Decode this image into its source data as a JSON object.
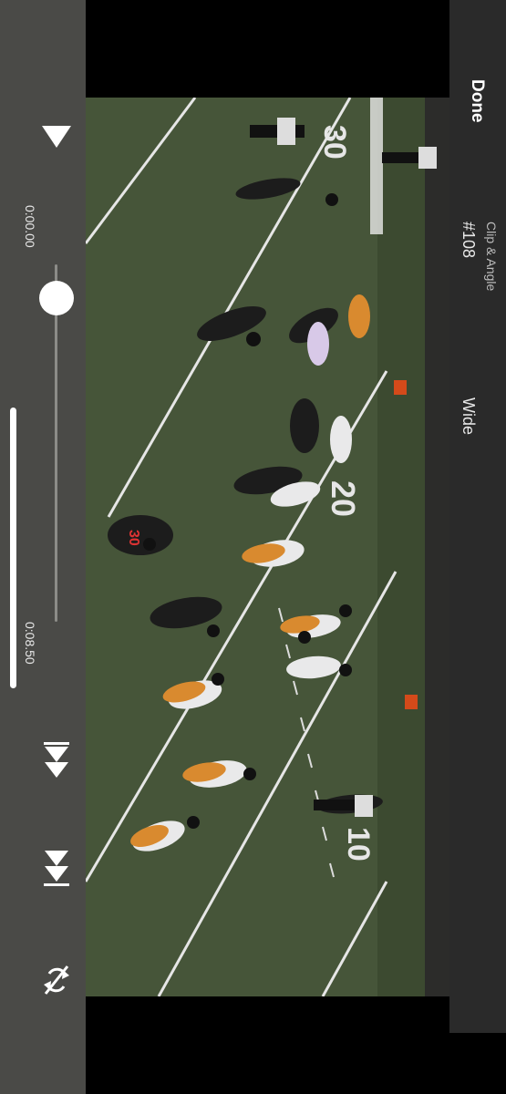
{
  "playback": {
    "current_time": "0:00.00",
    "duration": "0:08.50",
    "progress": 0.0
  },
  "header": {
    "done_label": "Done",
    "clip_label": "Clip & Angle",
    "clip_number": "#108",
    "angle": "Wide"
  },
  "icons": {
    "play": "play-icon",
    "previous": "skip-previous-icon",
    "next": "skip-next-icon",
    "rotate": "rotate-lock-icon"
  },
  "video_overlay": {
    "jersey_number": "30"
  },
  "colors": {
    "control_bg": "#4a4a47",
    "panel_bg": "#2a2a2a",
    "field_green": "#4a5a3c"
  }
}
